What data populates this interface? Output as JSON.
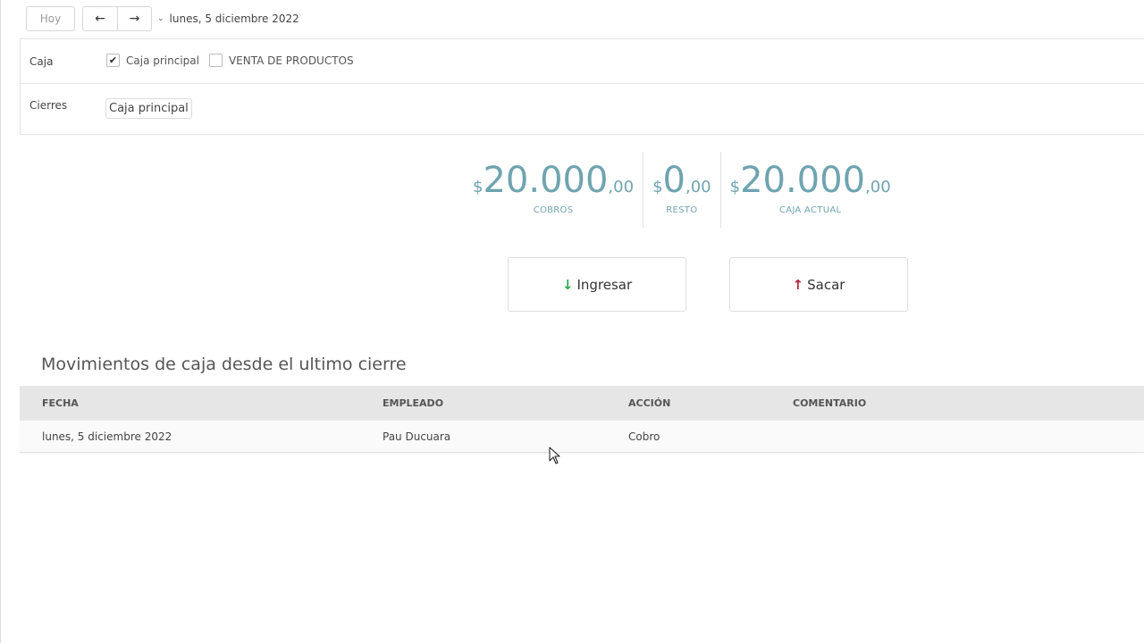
{
  "toolbar": {
    "today_label": "Hoy",
    "prev_icon": "arrow-left-icon",
    "next_icon": "arrow-right-icon",
    "date_label": "lunes, 5 diciembre 2022"
  },
  "filters": {
    "caja_label": "Caja",
    "options": [
      {
        "label": "Caja principal",
        "checked": true
      },
      {
        "label": "VENTA DE PRODUCTOS",
        "checked": false
      }
    ],
    "cierres_label": "Cierres",
    "cierres_value": "Caja principal"
  },
  "summary": [
    {
      "currency": "$",
      "amount": "20.000",
      "cents": ",00",
      "label": "COBROS"
    },
    {
      "currency": "$",
      "amount": "0",
      "cents": ",00",
      "label": "RESTO"
    },
    {
      "currency": "$",
      "amount": "20.000",
      "cents": ",00",
      "label": "CAJA ACTUAL"
    }
  ],
  "actions": {
    "ingresar_label": "Ingresar",
    "sacar_label": "Sacar"
  },
  "movements": {
    "title": "Movimientos de caja desde el ultimo cierre",
    "columns": [
      "FECHA",
      "EMPLEADO",
      "ACCIÓN",
      "COMENTARIO"
    ],
    "rows": [
      [
        "lunes, 5 diciembre 2022",
        "Pau Ducuara",
        "Cobro",
        ""
      ]
    ]
  },
  "colors": {
    "accent": "#6fa4b0",
    "ingresar_icon": "#2fa84f",
    "sacar_icon": "#b0263a"
  }
}
